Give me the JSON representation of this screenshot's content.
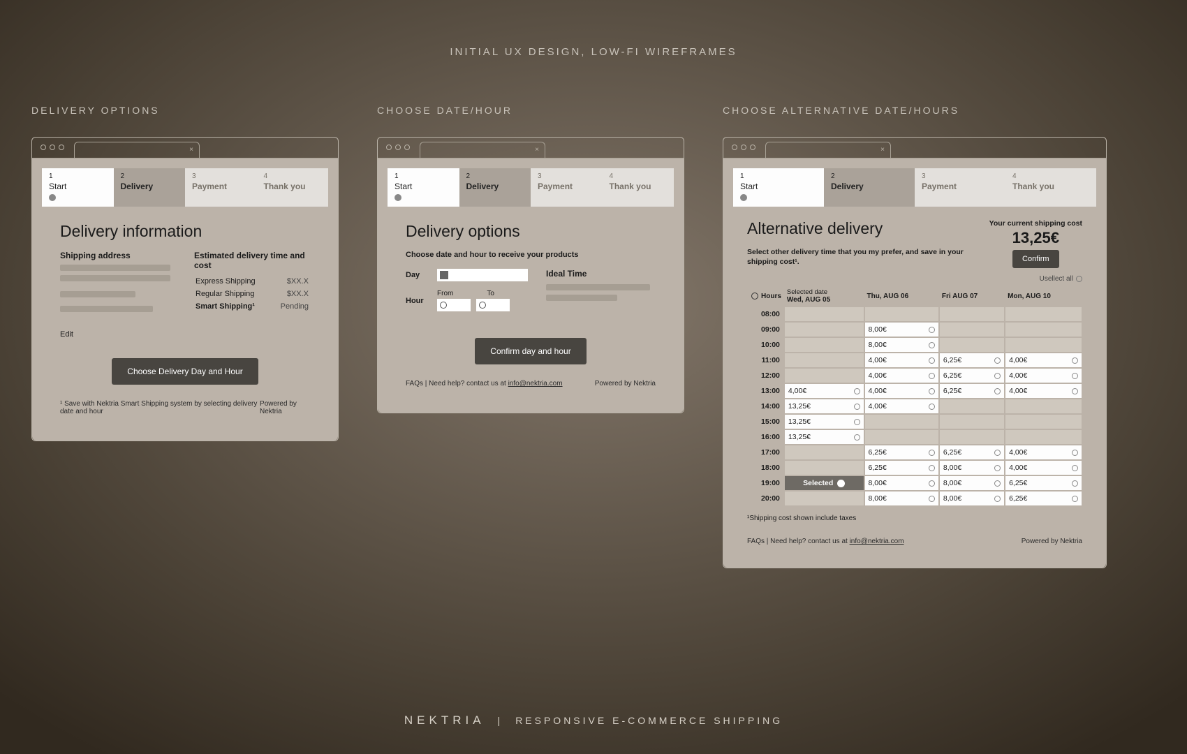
{
  "pageTitle": "INITIAL UX DESIGN, LOW-FI WIREFRAMES",
  "steps": [
    {
      "n": "1",
      "label": "Start"
    },
    {
      "n": "2",
      "label": "Delivery"
    },
    {
      "n": "3",
      "label": "Payment"
    },
    {
      "n": "4",
      "label": "Thank you"
    }
  ],
  "screen1": {
    "label": "DELIVERY OPTIONS",
    "title": "Delivery information",
    "shipHeader": "Shipping address",
    "estHeader": "Estimated delivery time and cost",
    "shipping": [
      {
        "name": "Express Shipping",
        "price": "$XX.X"
      },
      {
        "name": "Regular Shipping",
        "price": "$XX.X"
      },
      {
        "name": "Smart Shipping¹",
        "price": "Pending"
      }
    ],
    "edit": "Edit",
    "btn": "Choose Delivery Day and Hour",
    "footnote": "¹ Save with Nektria Smart Shipping system by selecting delivery date and hour",
    "powered": "Powered by Nektria"
  },
  "screen2": {
    "label": "CHOOSE DATE/HOUR",
    "title": "Delivery options",
    "sub": "Choose date and hour to receive your products",
    "day": "Day",
    "hour": "Hour",
    "from": "From",
    "to": "To",
    "ideal": "Ideal Time",
    "btn": "Confirm day and hour",
    "faq": "FAQs  |  Need help? contact us at ",
    "email": "info@nektria.com",
    "powered": "Powered by Nektria"
  },
  "screen3": {
    "label": "CHOOSE ALTERNATIVE DATE/HOURS",
    "title": "Alternative delivery",
    "sub": "Select other delivery time that you my prefer, and save in your shipping cost¹.",
    "costLabel": "Your current shipping cost",
    "cost": "13,25€",
    "confirm": "Confirm",
    "unselect": "Usellect all",
    "hoursLabel": "Hours",
    "columns": [
      {
        "top": "Selected date",
        "bot": "Wed, AUG 05"
      },
      {
        "top": "",
        "bot": "Thu, AUG 06"
      },
      {
        "top": "",
        "bot": "Fri AUG 07"
      },
      {
        "top": "",
        "bot": "Mon, AUG 10"
      }
    ],
    "hours": [
      "08:00",
      "09:00",
      "10:00",
      "11:00",
      "12:00",
      "13:00",
      "14:00",
      "15:00",
      "16:00",
      "17:00",
      "18:00",
      "19:00",
      "20:00"
    ],
    "grid": [
      [
        "",
        "",
        "",
        ""
      ],
      [
        "",
        "8,00€",
        "",
        ""
      ],
      [
        "",
        "8,00€",
        "",
        ""
      ],
      [
        "",
        "4,00€",
        "6,25€",
        "4,00€"
      ],
      [
        "",
        "4,00€",
        "6,25€",
        "4,00€"
      ],
      [
        "4,00€",
        "4,00€",
        "6,25€",
        "4,00€"
      ],
      [
        "13,25€",
        "4,00€",
        "",
        ""
      ],
      [
        "13,25€",
        "",
        "",
        ""
      ],
      [
        "13,25€",
        "",
        "",
        ""
      ],
      [
        "",
        "6,25€",
        "6,25€",
        "4,00€"
      ],
      [
        "",
        "6,25€",
        "8,00€",
        "4,00€"
      ],
      [
        "SELECTED",
        "8,00€",
        "8,00€",
        "6,25€"
      ],
      [
        "",
        "8,00€",
        "8,00€",
        "6,25€"
      ]
    ],
    "selectedLabel": "Selected",
    "note": "¹Shipping cost shown include taxes",
    "faq": "FAQs  |  Need help? contact us at ",
    "email": "info@nektria.com",
    "powered": "Powered by Nektria"
  },
  "brand": {
    "name": "NEKTRIA",
    "tag": "RESPONSIVE E-COMMERCE SHIPPING"
  }
}
